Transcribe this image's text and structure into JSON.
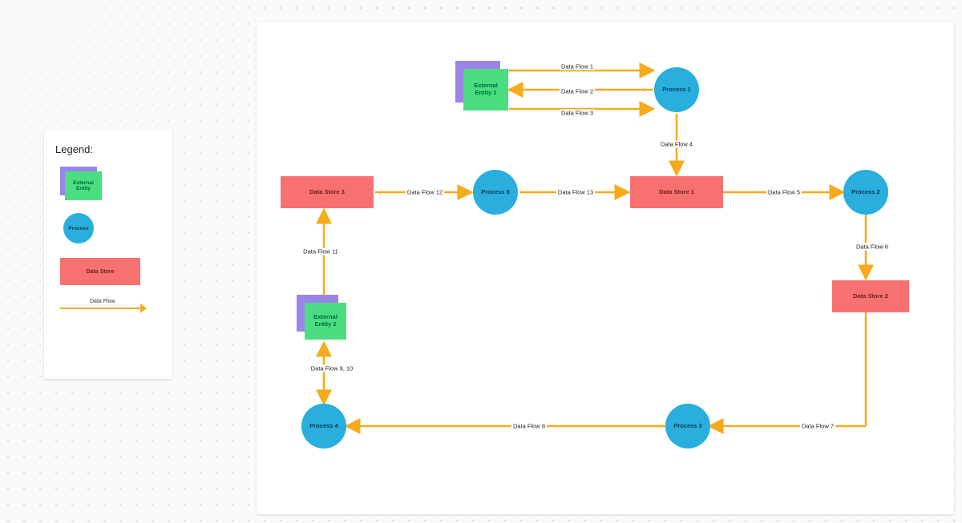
{
  "legend": {
    "title": "Legend:",
    "external_entity_label": "External\nEntity",
    "process_label": "Process",
    "data_store_label": "Data Store",
    "data_flow_label": "Data Flow"
  },
  "nodes": {
    "external_entity_1": "External\nEntity 1",
    "external_entity_2": "External\nEntity 2",
    "process_1": "Process 1",
    "process_2": "Process 2",
    "process_3": "Process 3",
    "process_4": "Process 4",
    "process_5": "Process 5",
    "data_store_1": "Data Store 1",
    "data_store_2": "Data Store 2",
    "data_store_3": "Data Store 3"
  },
  "flows": {
    "flow1": "Data Flow 1",
    "flow2": "Data Flow 2",
    "flow3": "Data Flow 3",
    "flow4": "Data Flow 4",
    "flow5": "Data Flow 5",
    "flow6": "Data Flow 6",
    "flow7": "Data Flow 7",
    "flow8": "Data Flow 8",
    "flow9_10": "Data Flow 9, 10",
    "flow11": "Data Flow 11",
    "flow12": "Data Flow 12",
    "flow13": "Data Flow 13"
  },
  "colors": {
    "process": "#29aede",
    "store": "#f87171",
    "entity_front": "#4ade80",
    "entity_back": "#9b84e8",
    "flow": "#f5ab1b"
  },
  "diagram": {
    "edges": [
      {
        "from": "external_entity_1",
        "to": "process_1",
        "label": "Data Flow 1"
      },
      {
        "from": "process_1",
        "to": "external_entity_1",
        "label": "Data Flow 2"
      },
      {
        "from": "external_entity_1",
        "to": "process_1",
        "label": "Data Flow 3"
      },
      {
        "from": "process_1",
        "to": "data_store_1",
        "label": "Data Flow 4"
      },
      {
        "from": "data_store_1",
        "to": "process_2",
        "label": "Data Flow 5"
      },
      {
        "from": "process_2",
        "to": "data_store_2",
        "label": "Data Flow 6"
      },
      {
        "from": "data_store_2",
        "to": "process_3",
        "label": "Data Flow 7"
      },
      {
        "from": "process_3",
        "to": "process_4",
        "label": "Data Flow 8"
      },
      {
        "from": "process_4",
        "to": "external_entity_2",
        "label": "Data Flow 9, 10",
        "bidirectional": true
      },
      {
        "from": "external_entity_2",
        "to": "data_store_3",
        "label": "Data Flow 11"
      },
      {
        "from": "data_store_3",
        "to": "process_5",
        "label": "Data Flow 12"
      },
      {
        "from": "process_5",
        "to": "data_store_1",
        "label": "Data Flow 13"
      }
    ]
  }
}
